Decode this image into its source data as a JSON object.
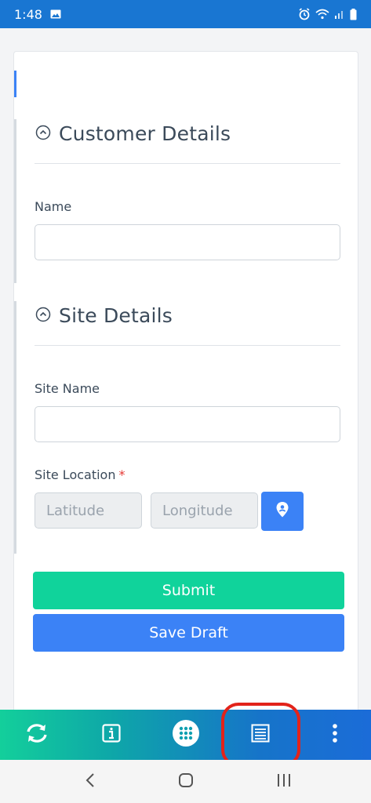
{
  "status_bar": {
    "time": "1:48",
    "icons": [
      "image-icon",
      "alarm-icon",
      "wifi-icon",
      "signal-icon",
      "battery-icon"
    ]
  },
  "form": {
    "customer_section": {
      "title": "Customer Details",
      "name_label": "Name",
      "name_value": ""
    },
    "site_section": {
      "title": "Site Details",
      "site_name_label": "Site Name",
      "site_name_value": "",
      "site_location_label": "Site Location",
      "required_marker": "*",
      "latitude_placeholder": "Latitude",
      "longitude_placeholder": "Longitude"
    },
    "submit_label": "Submit",
    "save_draft_label": "Save Draft"
  },
  "toolbar": {
    "items": [
      "sync-icon",
      "info-icon",
      "apps-grid-icon",
      "form-list-icon",
      "more-vertical-icon"
    ],
    "highlighted": "form-list-icon"
  },
  "colors": {
    "status_bar": "#1976d2",
    "submit": "#10d39b",
    "save_draft": "#3b82f6",
    "highlight": "#e2231a"
  }
}
